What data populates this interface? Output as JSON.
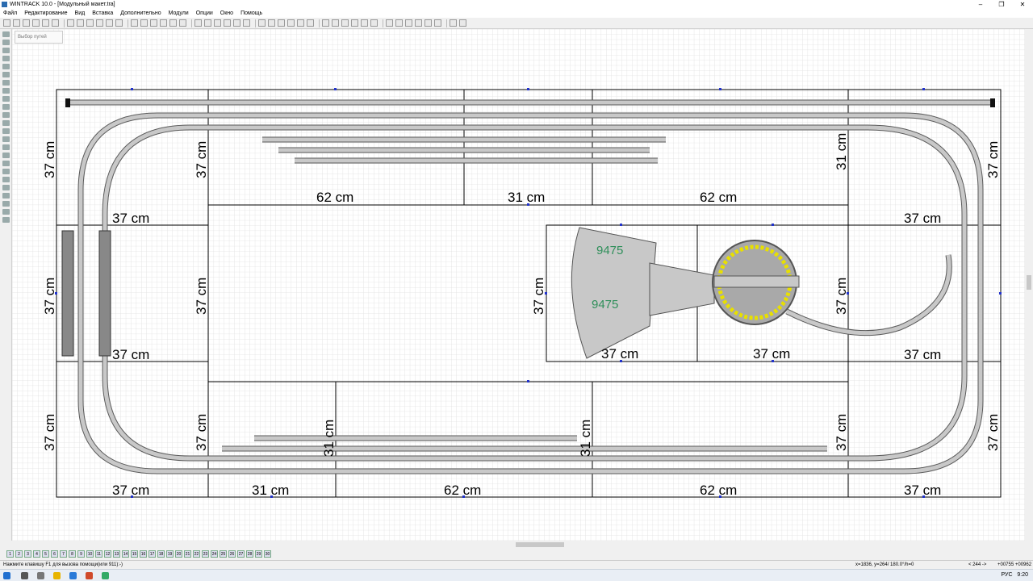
{
  "window": {
    "title": "WINTRACK 10.0 - [Модульный макет.tra]",
    "controls": [
      "–",
      "❐",
      "✕"
    ]
  },
  "menu": [
    "Файл",
    "Редактирование",
    "Вид",
    "Вставка",
    "Дополнительно",
    "Модули",
    "Опции",
    "Окно",
    "Помощь"
  ],
  "popup_hint": "Выбор путей",
  "layout": {
    "module_labels": {
      "left_col": "37 cm",
      "top_62_a": "62 cm",
      "top_31": "31 cm",
      "top_62_b": "62 cm",
      "right_row": "37 cm",
      "left_row_upper": "37 cm",
      "left_row_lower": "37 cm",
      "mid_37_a": "37 cm",
      "mid_37_b": "37 cm",
      "right_37_lower": "37 cm",
      "bottom_37_left": "37 cm",
      "bottom_31": "31 cm",
      "bottom_62_a": "62 cm",
      "bottom_62_b": "62 cm",
      "bottom_37_right": "37 cm",
      "vert_37": "37 cm",
      "vert_31": "31 cm"
    },
    "turntable_label_a": "9475",
    "turntable_label_b": "9475"
  },
  "status": {
    "hint": "Нажмите клавишу F1 для вызова помощи(или 911):-)",
    "coords": "x=1836, y=264/ 180.0°/h=0",
    "zoom": "< 244 ->",
    "position": "+00755 +00962"
  },
  "page_tabs": [
    "1",
    "2",
    "3",
    "4",
    "5",
    "6",
    "7",
    "8",
    "9",
    "10",
    "11",
    "12",
    "13",
    "14",
    "15",
    "16",
    "17",
    "18",
    "19",
    "20",
    "21",
    "22",
    "23",
    "24",
    "25",
    "26",
    "27",
    "28",
    "29",
    "30"
  ],
  "taskbar": {
    "lang": "РУС",
    "time": "9:20"
  },
  "colors": {
    "grid": "#d6d6d6",
    "module_line": "#000000",
    "track_fill": "#c8c8c8",
    "track_outline": "#5a5a5a",
    "label_green": "#2f8f5a",
    "turntable_dots": "#e8e000"
  }
}
